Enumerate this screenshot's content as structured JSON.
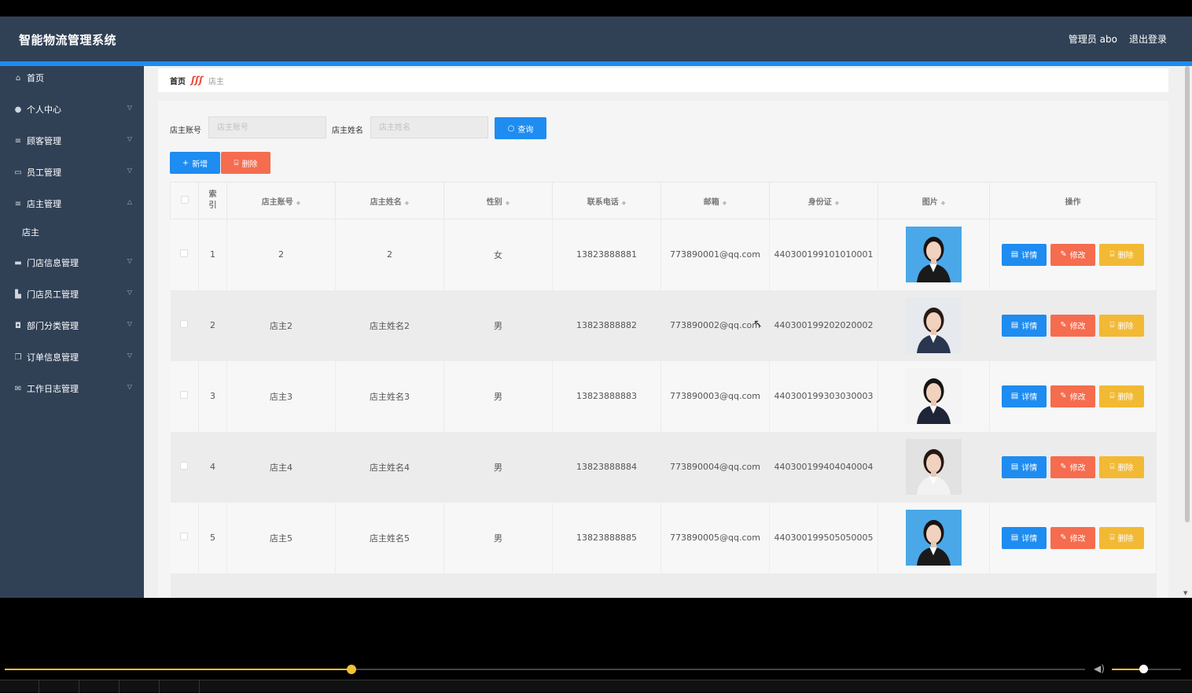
{
  "header": {
    "title": "智能物流管理系统",
    "user_label": "管理员 abo",
    "logout_label": "退出登录"
  },
  "sidebar": {
    "items": [
      {
        "label": "首页",
        "icon": "home-icon"
      },
      {
        "label": "个人中心",
        "icon": "user-icon"
      },
      {
        "label": "顾客管理",
        "icon": "list-icon"
      },
      {
        "label": "员工管理",
        "icon": "chat-icon"
      },
      {
        "label": "店主管理",
        "icon": "list-icon"
      },
      {
        "label": "门店信息管理",
        "icon": "shop-icon"
      },
      {
        "label": "门店员工管理",
        "icon": "thumb-icon"
      },
      {
        "label": "部门分类管理",
        "icon": "gauge-icon"
      },
      {
        "label": "订单信息管理",
        "icon": "copy-icon"
      },
      {
        "label": "工作日志管理",
        "icon": "mail-icon"
      }
    ],
    "sub_item": "店主"
  },
  "breadcrumb": {
    "home": "首页",
    "current": "店主"
  },
  "search": {
    "account_label": "店主账号",
    "account_placeholder": "店主账号",
    "name_label": "店主姓名",
    "name_placeholder": "店主姓名",
    "query_label": "查询"
  },
  "toolbar": {
    "add_label": "新增",
    "delete_label": "删除"
  },
  "table": {
    "headers": {
      "index": "索引",
      "account": "店主账号",
      "name": "店主姓名",
      "gender": "性别",
      "phone": "联系电话",
      "email": "邮箱",
      "id_card": "身份证",
      "photo": "图片",
      "ops": "操作"
    },
    "rows": [
      {
        "index": "1",
        "account": "2",
        "name": "2",
        "gender": "女",
        "phone": "13823888881",
        "email": "773890001@qq.com",
        "id_card": "440300199101010001"
      },
      {
        "index": "2",
        "account": "店主2",
        "name": "店主姓名2",
        "gender": "男",
        "phone": "13823888882",
        "email": "773890002@qq.com",
        "id_card": "440300199202020002"
      },
      {
        "index": "3",
        "account": "店主3",
        "name": "店主姓名3",
        "gender": "男",
        "phone": "13823888883",
        "email": "773890003@qq.com",
        "id_card": "440300199303030003"
      },
      {
        "index": "4",
        "account": "店主4",
        "name": "店主姓名4",
        "gender": "男",
        "phone": "13823888884",
        "email": "773890004@qq.com",
        "id_card": "440300199404040004"
      },
      {
        "index": "5",
        "account": "店主5",
        "name": "店主姓名5",
        "gender": "男",
        "phone": "13823888885",
        "email": "773890005@qq.com",
        "id_card": "440300199505050005"
      }
    ],
    "ops": {
      "detail": "详情",
      "edit": "修改",
      "delete": "删除"
    }
  },
  "player": {
    "progress": 0.321,
    "volume": 0.45
  },
  "colors": {
    "header_bg": "#304156",
    "accent_blue": "#1e8cf0",
    "danger": "#f56c4f",
    "warning": "#f2b934",
    "progress": "#f2c230"
  }
}
